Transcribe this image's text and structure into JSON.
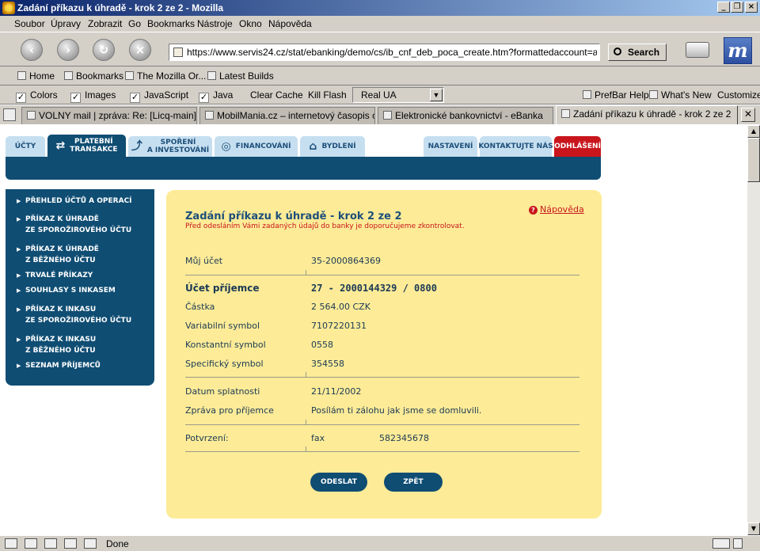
{
  "window": {
    "title": "Zadání příkazu k úhradě - krok 2 ze 2 - Mozilla"
  },
  "menu": [
    "Soubor",
    "Úpravy",
    "Zobrazit",
    "Go",
    "Bookmarks",
    "Nástroje",
    "Okno",
    "Nápověda"
  ],
  "nav": {
    "url": "https://www.servis24.cz/stat/ebanking/demo/cs/ib_cnf_deb_poca_create.htm?formattedaccount=accou",
    "search_label": "Search"
  },
  "personal_toolbar": [
    "Home",
    "Bookmarks",
    "The Mozilla Or...",
    "Latest Builds"
  ],
  "prefbar": {
    "checks": [
      "Colors",
      "Images",
      "JavaScript",
      "Java"
    ],
    "buttons": [
      "Clear Cache",
      "Kill Flash"
    ],
    "ua_value": "Real UA",
    "right_buttons": [
      "PrefBar Help",
      "What's New",
      "Customize"
    ]
  },
  "browser_tabs": [
    "VOLNY mail | zpráva: Re: [Licq-main] ...",
    "MobilMania.cz – internetový časopis o...",
    "Elektronické bankovnictví - eBanka",
    "Zadání příkazu k úhradě - krok 2 ze 2"
  ],
  "site_tabs": {
    "ucty": "ÚČTY",
    "platebni_1": "PLATEBNÍ",
    "platebni_2": "TRANSAKCE",
    "sporeni_1": "SPOŘENÍ",
    "sporeni_2": "A INVESTOVÁNÍ",
    "financovani": "FINANCOVÁNÍ",
    "bydleni": "BYDLENÍ",
    "nastaveni": "NASTAVENÍ",
    "kontakt": "KONTAKTUJTE NÁS",
    "odhlaseni": "ODHLÁŠENÍ"
  },
  "left_menu": [
    [
      "PŘEHLED ÚČTŮ A OPERACÍ"
    ],
    [
      "PŘÍKAZ K ÚHRADĚ",
      "ZE SPOROŽIROVÉHO ÚČTU"
    ],
    [
      "PŘÍKAZ K ÚHRADĚ",
      "Z BĚŽNÉHO ÚČTU"
    ],
    [
      "TRVALÉ PŘÍKAZY"
    ],
    [
      "SOUHLASY S INKASEM"
    ],
    [
      "PŘÍKAZ K INKASU",
      "ZE SPOROŽIROVÉHO ÚČTU"
    ],
    [
      "PŘÍKAZ K INKASU",
      "Z BĚŽNÉHO ÚČTU"
    ],
    [
      "SEZNAM PŘÍJEMCŮ"
    ]
  ],
  "form": {
    "title": "Zadání příkazu k úhradě - krok 2 ze 2",
    "subtitle": "Před odesláním Vámi zadaných údajů do banky je doporučujeme zkontrolovat.",
    "help": "Nápověda",
    "fields": {
      "muj_ucet_label": "Můj účet",
      "muj_ucet": "35-2000864369",
      "ucet_prijemce_label": "Účet příjemce",
      "ucet_prijemce": "27 - 2000144329  /  0800",
      "castka_label": "Částka",
      "castka": "2 564.00 CZK",
      "vs_label": "Variabilní symbol",
      "vs": "7107220131",
      "ks_label": "Konstantní symbol",
      "ks": "0558",
      "ss_label": "Specifický symbol",
      "ss": "354558",
      "datum_label": "Datum splatnosti",
      "datum": "21/11/2002",
      "zprava_label": "Zpráva pro příjemce",
      "zprava": "Posílám ti zálohu jak jsme se domluvili.",
      "potvrzeni_label": "Potvrzení:",
      "potvrzeni_typ": "fax",
      "potvrzeni_cislo": "582345678"
    },
    "btn_odeslat": "ODESLAT",
    "btn_zpet": "ZPĚT"
  },
  "status": "Done"
}
